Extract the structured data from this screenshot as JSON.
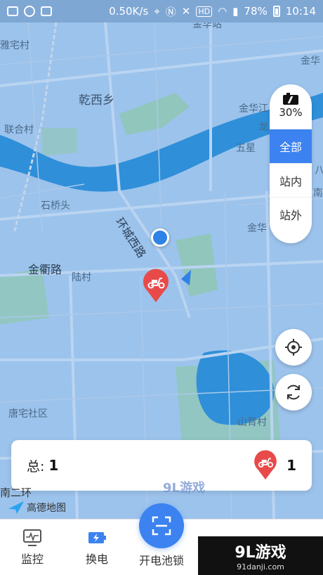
{
  "status_bar": {
    "speed": "0.50K/s",
    "hd_badge": "HD",
    "battery": "78%",
    "time": "10:14"
  },
  "map": {
    "labels": {
      "jinhua_station": "金华站",
      "village_nw": "雅宅村",
      "jinhua_ne": "金华",
      "qianxi": "乾西乡",
      "jinhuajiang": "金华江",
      "long": "龙",
      "lianhe": "联合村",
      "wuxing": "五星",
      "ba": "八",
      "nan": "南",
      "shiqiaotou": "石桥头",
      "huancheng_xilu": "环城西路",
      "jinhua_mid": "金华",
      "jinqu_lu": "金衢路",
      "luocun": "陆村",
      "tangzhai": "唐宅社区",
      "shanbei": "山背村"
    },
    "colors": {
      "land": "#9cc3ec",
      "water": "#2f8fd9",
      "green": "#8fc7b0",
      "road": "#b9d4f1"
    }
  },
  "filter_panel": {
    "battery_level": "30%",
    "options": [
      "全部",
      "站内",
      "站外"
    ],
    "selected": "全部"
  },
  "summary": {
    "total_label": "总:",
    "total_value": "1",
    "scooter_count": "1"
  },
  "attribution": {
    "amap": "高德地图",
    "road": "南二环"
  },
  "bottom_nav": {
    "items": [
      "监控",
      "换电",
      "开电池锁",
      "开"
    ],
    "accent": "#3c82f0"
  },
  "watermark": {
    "main": "9L游戏",
    "sub": "91danji.com",
    "overlay": "9L游戏"
  },
  "icons": [
    "location-target-icon",
    "refresh-icon",
    "scooter-pin-icon",
    "scan-icon",
    "monitor-icon",
    "battery-swap-icon"
  ]
}
